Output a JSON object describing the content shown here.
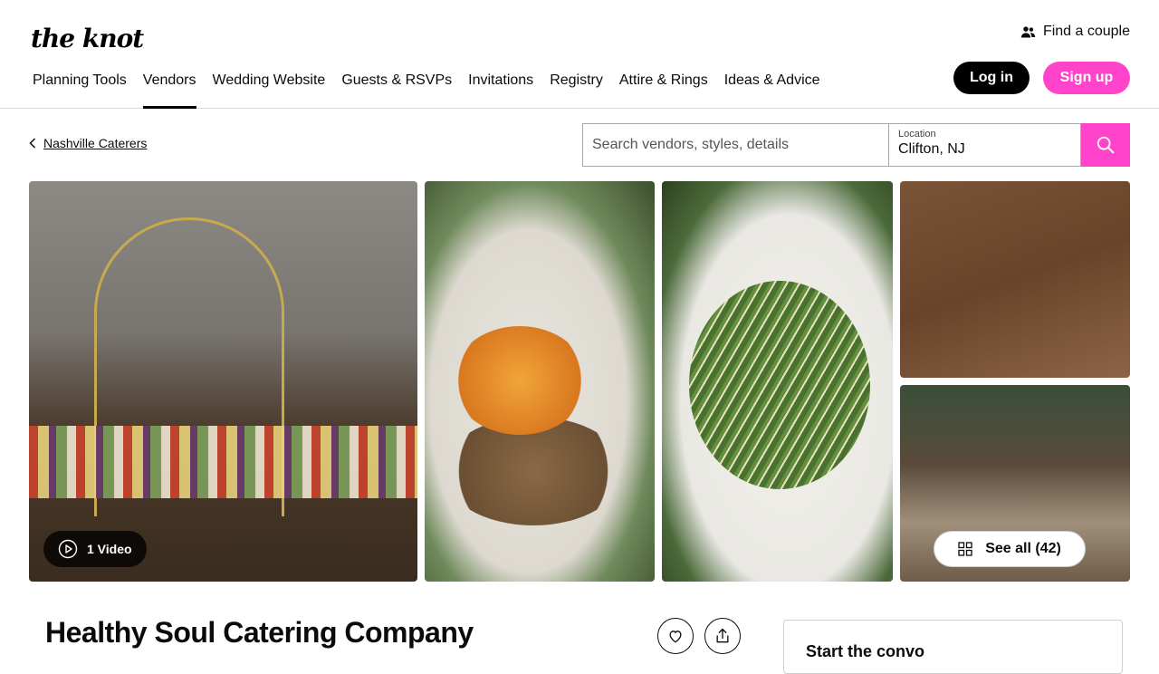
{
  "brand": {
    "logo_text": "the knot"
  },
  "header": {
    "find_couple": "Find a couple",
    "login": "Log in",
    "signup": "Sign up",
    "nav": [
      "Planning Tools",
      "Vendors",
      "Wedding Website",
      "Guests & RSVPs",
      "Invitations",
      "Registry",
      "Attire & Rings",
      "Ideas & Advice"
    ],
    "active_nav": "Vendors"
  },
  "breadcrumb": {
    "label": "Nashville Caterers"
  },
  "search": {
    "placeholder": "Search vendors, styles, details",
    "location_label": "Location",
    "location_value": "Clifton, NJ"
  },
  "gallery": {
    "video_label": "1 Video",
    "see_all_label": "See all (42)"
  },
  "vendor": {
    "name": "Healthy Soul Catering Company",
    "conversation_title": "Start the convo"
  },
  "colors": {
    "accent": "#ff44cb",
    "text": "#0b0b0b"
  }
}
